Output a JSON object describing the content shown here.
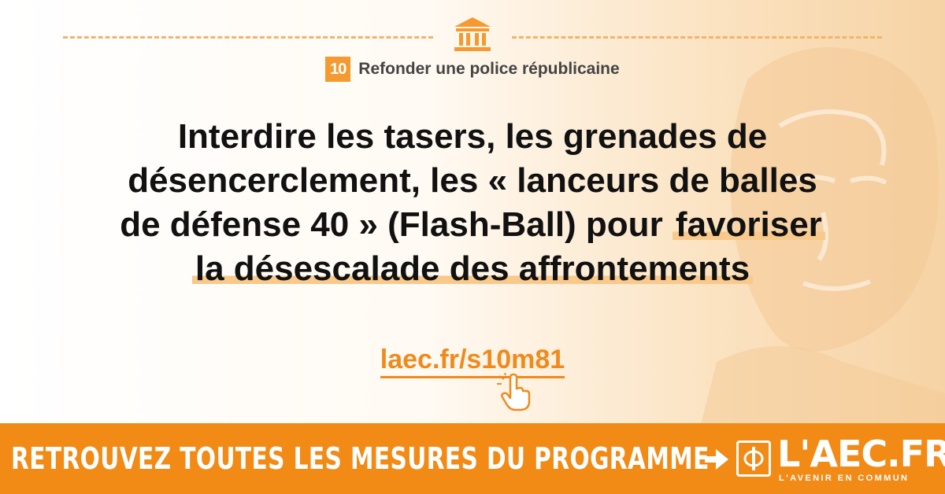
{
  "section": {
    "number": "10",
    "title": "Refonder une police républicaine"
  },
  "headline": {
    "line1": "Interdire les tasers, les grenades de",
    "line2": "désencerclement, les « lanceurs de balles",
    "line3_plain": "de défense 40 » (Flash-Ball) pour ",
    "line3_highlight": "favoriser",
    "line4_highlight": "la désescalade des affrontements"
  },
  "link": {
    "text": "laec.fr/s10m81"
  },
  "footer": {
    "cta": "RETROUVEZ TOUTES LES MESURES DU PROGRAMME",
    "logo_text": "L'AEC.FR",
    "logo_tagline": "L'AVENIR EN COMMUN"
  },
  "icons": {
    "building": "building-columns-icon",
    "hand": "pointing-hand-icon",
    "arrow": "arrow-right-icon"
  },
  "colors": {
    "accent": "#f28a16",
    "highlight": "#f8c98a",
    "dash": "#f1b46b",
    "text": "#111111"
  }
}
